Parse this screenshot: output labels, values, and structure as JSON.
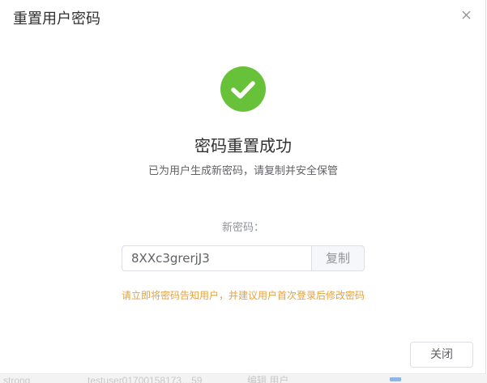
{
  "dialog": {
    "title": "重置用户密码",
    "close_icon": "close-icon"
  },
  "result": {
    "icon": "check-circle-icon",
    "icon_color": "#67c23a",
    "title": "密码重置成功",
    "subtitle": "已为用户生成新密码，请复制并安全保管"
  },
  "password": {
    "label": "新密码：",
    "value": "8XXc3grerjJ3",
    "copy_label": "复制"
  },
  "warning": {
    "text": "请立即将密码告知用户，并建议用户首次登录后修改密码",
    "color": "#e6a23c"
  },
  "footer": {
    "close_label": "关闭"
  },
  "background": {
    "fragments": [
      "strong",
      "testuser01700158173…59",
      "编辑 用户"
    ]
  }
}
